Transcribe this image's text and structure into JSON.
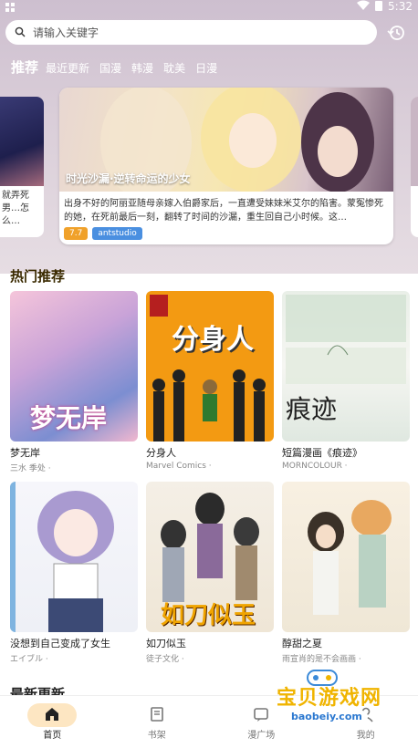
{
  "status": {
    "time": "5:32"
  },
  "search": {
    "placeholder": "请输入关键字"
  },
  "tabs": [
    {
      "label": "推荐",
      "active": true
    },
    {
      "label": "最近更新"
    },
    {
      "label": "国漫"
    },
    {
      "label": "韩漫"
    },
    {
      "label": "耽美"
    },
    {
      "label": "日漫"
    }
  ],
  "side_left": {
    "text": "就弄死男…怎么…"
  },
  "featured": {
    "caption": "时光沙漏·逆转命运的少女",
    "description": "出身不好的阿丽亚随母亲嫁入伯爵家后，一直遭受妹妹米艾尔的陷害。蒙冤惨死的她，在死前最后一刻，翻转了时间的沙漏，重生回自己小时候。这…",
    "score": "7.7",
    "tag": "antstudio"
  },
  "section": {
    "title": "热门推荐",
    "next_title": "最新更新"
  },
  "comics": [
    {
      "name": "梦无岸",
      "author": "三水 季处 ·",
      "cover_text": "梦无岸"
    },
    {
      "name": "分身人",
      "author": "Marvel Comics ·",
      "cover_text": "分身人"
    },
    {
      "name": "短篇漫画《痕迹》",
      "author": "MORNCOLOUR ·",
      "cover_text": "痕迹"
    },
    {
      "name": "没想到自己变成了女生",
      "author": "エイブル ·",
      "cover_text": ""
    },
    {
      "name": "如刀似玉",
      "author": "徒子文化 ·",
      "cover_text": "如刀似玉"
    },
    {
      "name": "醇甜之夏",
      "author": "雨宣肖的是不会画画 ·",
      "cover_text": ""
    }
  ],
  "nav": [
    {
      "label": "首页",
      "icon": "home-icon",
      "active": true
    },
    {
      "label": "书架",
      "icon": "bookshelf-icon"
    },
    {
      "label": "漫广场",
      "icon": "square-icon"
    },
    {
      "label": "我的",
      "icon": "profile-icon"
    }
  ],
  "watermark": {
    "text": "宝贝游戏网",
    "url": "baobeiy.com"
  },
  "colors": {
    "accent": "#fde6c2",
    "score": "#f0a12a",
    "tag": "#4a8fe0"
  }
}
